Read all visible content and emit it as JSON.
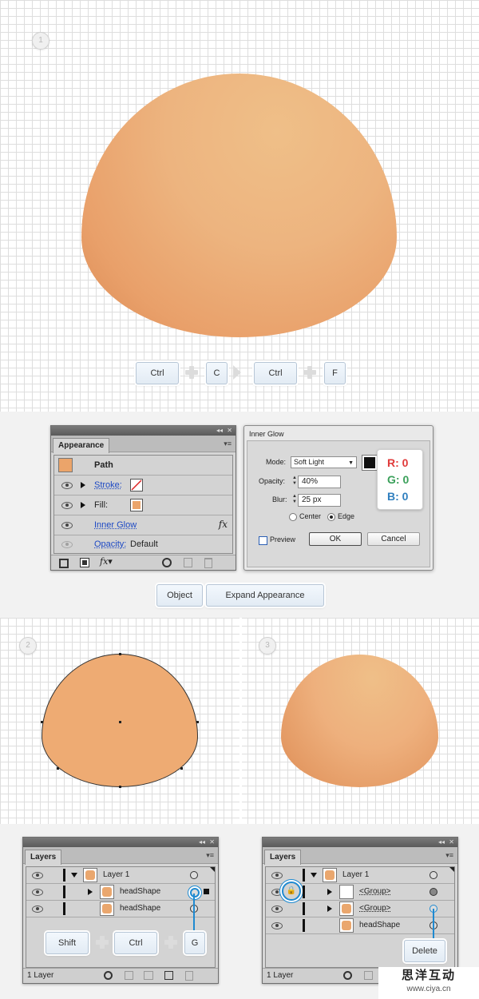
{
  "steps": [
    "1",
    "2",
    "3"
  ],
  "shortcut1": {
    "keys": [
      "Ctrl",
      "C",
      "Ctrl",
      "F"
    ]
  },
  "appearance": {
    "tab": "Appearance",
    "header": "Path",
    "rows": [
      {
        "label": "Stroke:",
        "link": true
      },
      {
        "label": "Fill:",
        "link": false
      },
      {
        "label": "Inner Glow",
        "link": true
      },
      {
        "label": "Opacity:",
        "value": "Default",
        "link": true
      }
    ],
    "fx": "fx"
  },
  "inner_glow": {
    "title": "Inner Glow",
    "mode_label": "Mode:",
    "mode_value": "Soft Light",
    "opacity_label": "Opacity:",
    "opacity_value": "40%",
    "blur_label": "Blur:",
    "blur_value": "25 px",
    "center_label": "Center",
    "edge_label": "Edge",
    "preview_label": "Preview",
    "ok": "OK",
    "cancel": "Cancel",
    "rgb": {
      "r": "R: 0",
      "g": "G: 0",
      "b": "B: 0"
    },
    "colors": {
      "r": "#e03a3a",
      "g": "#3aa05a",
      "b": "#2f7fbf"
    }
  },
  "menu_path": [
    "Object",
    "Expand Appearance"
  ],
  "layers_left": {
    "tab": "Layers",
    "rows": [
      "Layer 1",
      "headShape",
      "headShape"
    ],
    "footer": "1 Layer",
    "keys": [
      "Shift",
      "Ctrl",
      "G"
    ]
  },
  "layers_right": {
    "tab": "Layers",
    "rows": [
      "Layer 1",
      "<Group>",
      "<Group>",
      "headShape"
    ],
    "footer": "1 Layer",
    "delete_label": "Delete"
  },
  "watermark": {
    "line1": "思洋互动",
    "line2": "www.ciya.cn"
  },
  "accent": "#1f8ad1"
}
